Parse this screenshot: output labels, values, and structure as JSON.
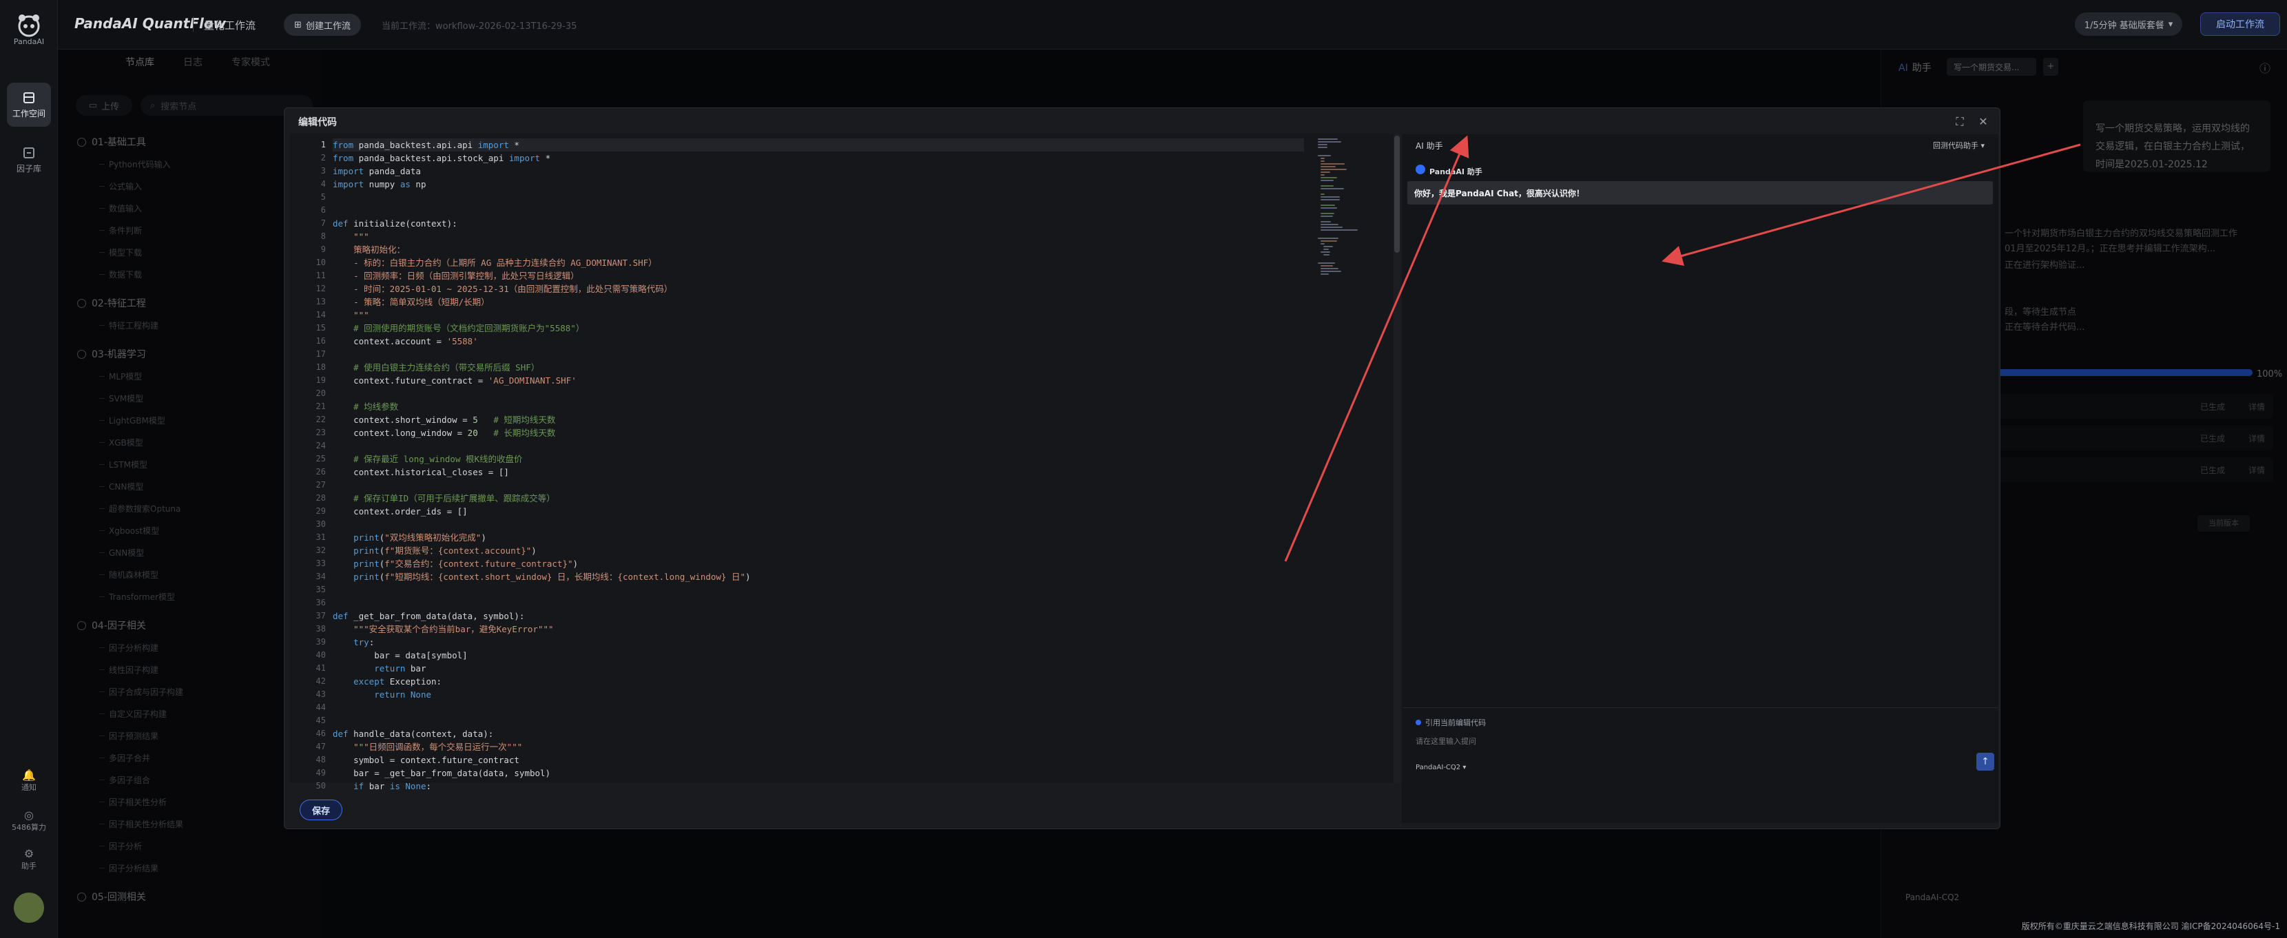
{
  "rail": {
    "logo_label": "PandaAI",
    "items": [
      {
        "label": "工作空间",
        "icon": "workspace-icon"
      },
      {
        "label": "因子库",
        "icon": "factor-icon"
      }
    ],
    "bottom": [
      {
        "label": "通知",
        "icon": "bell-icon"
      },
      {
        "label": "5486算力",
        "icon": "coin-icon"
      },
      {
        "label": "助手",
        "icon": "assistant-icon"
      }
    ]
  },
  "header": {
    "brand": "PandaAI QuantFlow",
    "section": "量化工作流",
    "new_button": "创建工作流",
    "workflow_name": "当前工作流：workflow-2026-02-13T16-29-35",
    "plan": "1/5分钟 基础版套餐",
    "run_button": "启动工作流"
  },
  "left": {
    "tabs": [
      "节点库",
      "日志",
      "专家模式"
    ],
    "active_tab": 0,
    "upload": "上传",
    "search_placeholder": "搜索节点",
    "groups": [
      {
        "title": "01-基础工具",
        "items": [
          "Python代码输入",
          "公式输入",
          "数值输入",
          "条件判断",
          "模型下载",
          "数据下载"
        ]
      },
      {
        "title": "02-特征工程",
        "items": [
          "特征工程构建"
        ]
      },
      {
        "title": "03-机器学习",
        "items": [
          "MLP模型",
          "SVM模型",
          "LightGBM模型",
          "XGB模型",
          "LSTM模型",
          "CNN模型",
          "超参数搜索Optuna",
          "Xgboost模型",
          "GNN模型",
          "随机森林模型",
          "Transformer模型"
        ]
      },
      {
        "title": "04-因子相关",
        "items": [
          "因子分析构建",
          "线性因子构建",
          "因子合成与因子构建",
          "自定义因子构建",
          "因子预测结果",
          "多因子合并",
          "多因子组合",
          "因子相关性分析",
          "因子相关性分析结果",
          "因子分析",
          "因子分析结果"
        ]
      },
      {
        "title": "05-回测相关",
        "items": []
      }
    ]
  },
  "right": {
    "title": "助手",
    "chip": "写一个期货交易...",
    "bubble": "写一个期货交易策略，运用双均线的交易逻辑，在白银主力合约上测试，时间是2025.01-2025.12",
    "status_lines": [
      "一个针对期货市场白银主力合约的双均线交易策略回测工作",
      "01月至2025年12月。；正在思考并编辑工作流架构...",
      "正在进行架构验证...",
      "段，等待生成节点",
      "正在等待合并代码..."
    ],
    "progress": 1.0,
    "progress_label": "100%",
    "rows": [
      {
        "status": "已生成",
        "detail": "详情"
      },
      {
        "status": "已生成",
        "detail": "详情"
      },
      {
        "status": "已生成",
        "detail": "详情"
      }
    ],
    "version_btn": "当前版本",
    "model": "PandaAI-CQ2"
  },
  "modal": {
    "title": "编辑代码",
    "save": "保存",
    "ai": {
      "header": "AI 助手",
      "mode": "回测代码助手",
      "name": "PandaAI 助手",
      "greeting": "你好，我是PandaAI Chat，很高兴认识你！",
      "ref_label": "引用当前编辑代码",
      "input_placeholder": "请在这里输入提问",
      "model": "PandaAI-CQ2",
      "send_icon": "arrow-up-icon"
    },
    "code": [
      "from panda_backtest.api.api import *",
      "from panda_backtest.api.stock_api import *",
      "import panda_data",
      "import numpy as np",
      "",
      "",
      "def initialize(context):",
      "    \"\"\"",
      "    策略初始化：",
      "    - 标的：白银主力合约（上期所 AG 品种主力连续合约 AG_DOMINANT.SHF）",
      "    - 回测频率：日频（由回测引擎控制，此处只写日线逻辑）",
      "    - 时间：2025-01-01 ~ 2025-12-31（由回测配置控制，此处只需写策略代码）",
      "    - 策略：简单双均线（短期/长期）",
      "    \"\"\"",
      "    # 回测使用的期货账号（文档约定回测期货账户为\"5588\"）",
      "    context.account = '5588'",
      "",
      "    # 使用白银主力连续合约（带交易所后缀 SHF）",
      "    context.future_contract = 'AG_DOMINANT.SHF'",
      "",
      "    # 均线参数",
      "    context.short_window = 5   # 短期均线天数",
      "    context.long_window = 20   # 长期均线天数",
      "",
      "    # 保存最近 long_window 根K线的收盘价",
      "    context.historical_closes = []",
      "",
      "    # 保存订单ID（可用于后续扩展撤单、跟踪成交等）",
      "    context.order_ids = []",
      "",
      "    print(\"双均线策略初始化完成\")",
      "    print(f\"期货账号：{context.account}\")",
      "    print(f\"交易合约：{context.future_contract}\")",
      "    print(f\"短期均线：{context.short_window} 日，长期均线：{context.long_window} 日\")",
      "",
      "",
      "def _get_bar_from_data(data, symbol):",
      "    \"\"\"安全获取某个合约当前bar，避免KeyError\"\"\"",
      "    try:",
      "        bar = data[symbol]",
      "        return bar",
      "    except Exception:",
      "        return None",
      "",
      "",
      "def handle_data(context, data):",
      "    \"\"\"日频回调函数，每个交易日运行一次\"\"\"",
      "    symbol = context.future_contract",
      "    bar = _get_bar_from_data(data, symbol)",
      "    if bar is None:"
    ]
  },
  "footer": "版权所有©重庆量云之端信息科技有限公司 渝ICP备2024046064号-1"
}
